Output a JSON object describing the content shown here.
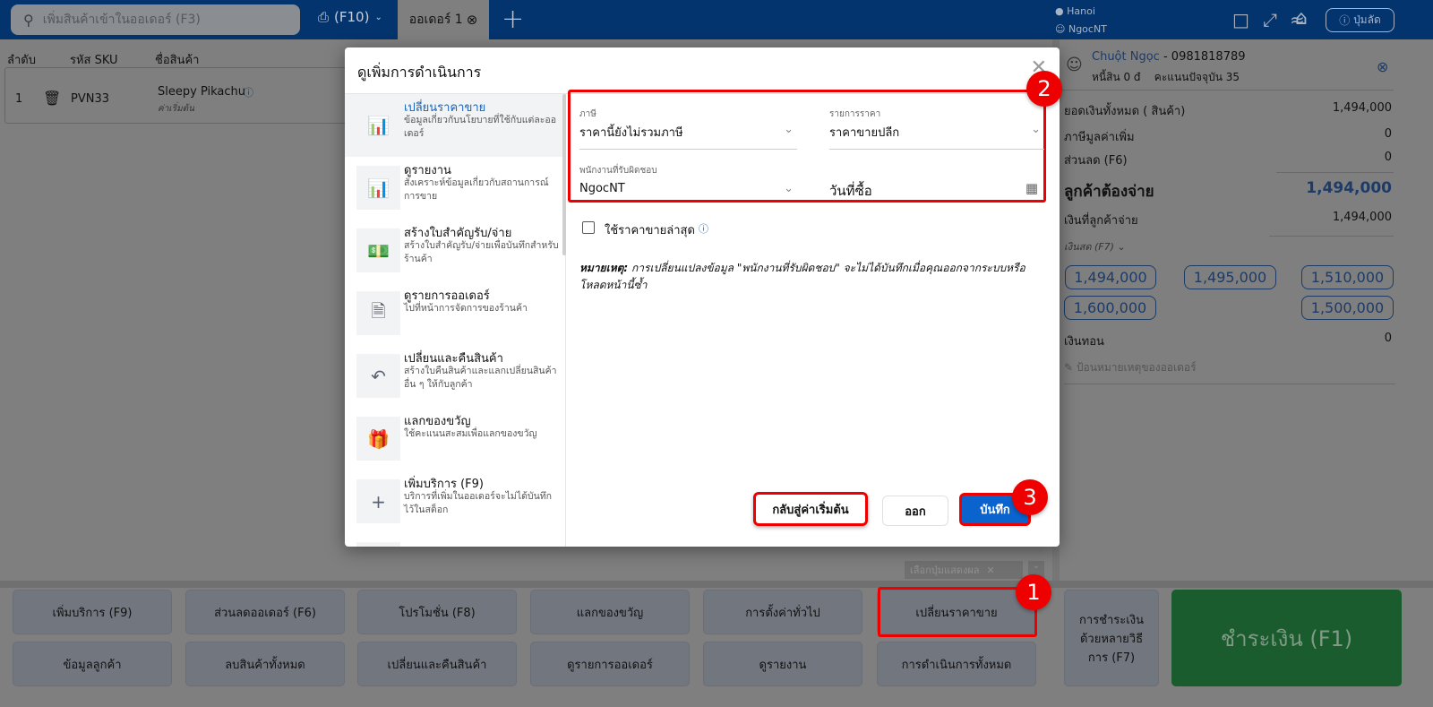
{
  "header": {
    "search_placeholder": "เพิ่มสินค้าเข้าในออเดอร์ (F3)",
    "scanner_label": "(F10)",
    "tab_label": "ออเดอร์ 1",
    "location": "Hanoi",
    "user": "NgocNT",
    "shortcut_label": "ปุ่มลัด"
  },
  "table": {
    "columns": [
      "ลำดับ",
      "รหัส SKU",
      "ชื่อสินค้า"
    ],
    "rows": [
      {
        "index": "1",
        "sku": "PVN33",
        "name": "Sleepy Pikachu",
        "note": "ค่าเริ่มต้น"
      }
    ]
  },
  "customer": {
    "name": "Chuột Ngọc",
    "phone": "- 0981818789",
    "debt": "หนี้สิน 0 đ",
    "points": "คะแนนปัจจุบัน 35"
  },
  "summary": {
    "total_label": "ยอดเงินทั้งหมด ( สินค้า)",
    "total": "1,494,000",
    "vat_label": "ภาษีมูลค่าเพิ่ม",
    "vat": "0",
    "discount_label": "ส่วนลด (F6)",
    "discount": "0",
    "must_pay_label": "ลูกค้าต้องจ่าย",
    "must_pay": "1,494,000",
    "paid_label": "เงินที่ลูกค้าจ่าย",
    "paid": "1,494,000",
    "method": "เงินสด (F7)",
    "cash_options": [
      "1,494,000",
      "1,495,000",
      "1,510,000",
      "1,600,000",
      "1,500,000"
    ],
    "change_label": "เงินทอน",
    "change": "0",
    "note_placeholder": "ป้อนหมายเหตุของออเดอร์"
  },
  "bottom": {
    "display_select": "เลือกปุ่มแสดงผล",
    "row1": [
      "เพิ่มบริการ (F9)",
      "ส่วนลดออเดอร์ (F6)",
      "โปรโมชั่น (F8)",
      "แลกของขวัญ",
      "การตั้งค่าทั่วไป",
      "เปลี่ยนราคาขาย"
    ],
    "row2": [
      "ข้อมูลลูกค้า",
      "ลบสินค้าทั้งหมด",
      "เปลี่ยนและคืนสินค้า",
      "ดูรายการออเดอร์",
      "ดูรายงาน",
      "การดำเนินการทั้งหมด"
    ],
    "multi_pay": "การชำระเงินด้วยหลายวิธีการ (F7)",
    "pay": "ชำระเงิน (F1)"
  },
  "modal": {
    "title": "ดูเพิ่มการดำเนินการ",
    "items": [
      {
        "title": "เปลี่ยนราคาขาย",
        "desc": "ข้อมูลเกี่ยวกับนโยบายที่ใช้กับแต่ละออเดอร์",
        "icon": "chart-icon"
      },
      {
        "title": "ดูรายงาน",
        "desc": "สังเคราะห์ข้อมูลเกี่ยวกับสถานการณ์การขาย",
        "icon": "chart-icon"
      },
      {
        "title": "สร้างใบสำคัญรับ/จ่าย",
        "desc": "สร้างใบสำคัญรับ/จ่ายเพื่อบันทึกสำหรับร้านค้า",
        "icon": "money-icon"
      },
      {
        "title": "ดูรายการออเดอร์",
        "desc": "ไปที่หน้าการจัดการของร้านค้า",
        "icon": "invoice-icon"
      },
      {
        "title": "เปลี่ยนและคืนสินค้า",
        "desc": "สร้างใบคืนสินค้าและแลกเปลี่ยนสินค้าอื่น ๆ ให้กับลูกค้า",
        "icon": "reply-icon"
      },
      {
        "title": "แลกของขวัญ",
        "desc": "ใช้คะแนนสะสมเพื่อแลกของขวัญ",
        "icon": "gift-icon"
      },
      {
        "title": "เพิ่มบริการ (F9)",
        "desc": "บริการที่เพิ่มในออเดอร์จะไม่ได้บันทึกไว้ในสต็อก",
        "icon": "plus-icon"
      }
    ],
    "tax_label": "ภาษี",
    "tax_value": "ราคานี้ยังไม่รวมภาษี",
    "price_list_label": "รายการราคา",
    "price_list_value": "ราคาขายปลีก",
    "staff_label": "พนักงานที่รับผิดชอบ",
    "staff_value": "NgocNT",
    "date_placeholder": "วันที่ซื้อ",
    "latest_price": "ใช้ราคาขายล่าสุด",
    "note_bold": "หมายเหตุ:",
    "note_text": " การเปลี่ยนแปลงข้อมูล \"พนักงานที่รับผิดชอบ\" จะไม่ได้บันทึกเมื่อคุณออกจากระบบหรือโหลดหน้านี้ซ้ำ",
    "reset": "กลับสู่ค่าเริ่มต้น",
    "exit": "ออก",
    "save": "บันทึก"
  },
  "annotations": [
    "1",
    "2",
    "3"
  ],
  "colors": {
    "primary": "#1565c0",
    "annotation": "#ee0000",
    "pay": "#1a5c2e"
  }
}
